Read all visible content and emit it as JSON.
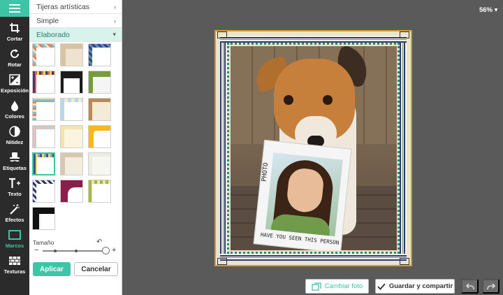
{
  "rail": {
    "tools": [
      {
        "label": "Cortar",
        "icon": "crop-icon"
      },
      {
        "label": "Rotar",
        "icon": "rotate-icon"
      },
      {
        "label": "Exposición",
        "icon": "exposure-icon"
      },
      {
        "label": "Colores",
        "icon": "droplet-icon"
      },
      {
        "label": "Nitidez",
        "icon": "sharpness-icon"
      },
      {
        "label": "Etiquetas",
        "icon": "mustache-hat-icon"
      },
      {
        "label": "Texto",
        "icon": "text-plus-icon"
      },
      {
        "label": "Efectos",
        "icon": "magic-wand-icon"
      },
      {
        "label": "Marcos",
        "icon": "frame-icon"
      },
      {
        "label": "Texturas",
        "icon": "brick-texture-icon"
      }
    ],
    "active": "Marcos"
  },
  "panel": {
    "categories": [
      {
        "label": "Tijeras artísticas",
        "chevron": "›"
      },
      {
        "label": "Simple",
        "chevron": "›"
      },
      {
        "label": "Elaborado",
        "chevron": "▾"
      }
    ],
    "size_label": "Tamaño",
    "size_value_fraction": 0.95,
    "apply_label": "Aplicar",
    "cancel_label": "Cancelar"
  },
  "canvas": {
    "zoom_label": "56%",
    "zoom_caret": "▾",
    "photo_text": "PHOTO",
    "caption": "HAVE YOU SEEN THIS PERSON"
  },
  "footer": {
    "change_photo_label": "Cambiar foto",
    "save_share_label": "Guardar y compartir"
  },
  "colors": {
    "accent": "#3ec4a6",
    "frame_orange": "#d79a2e",
    "frame_navy": "#2f3a72",
    "frame_green": "#7a9b4a"
  }
}
